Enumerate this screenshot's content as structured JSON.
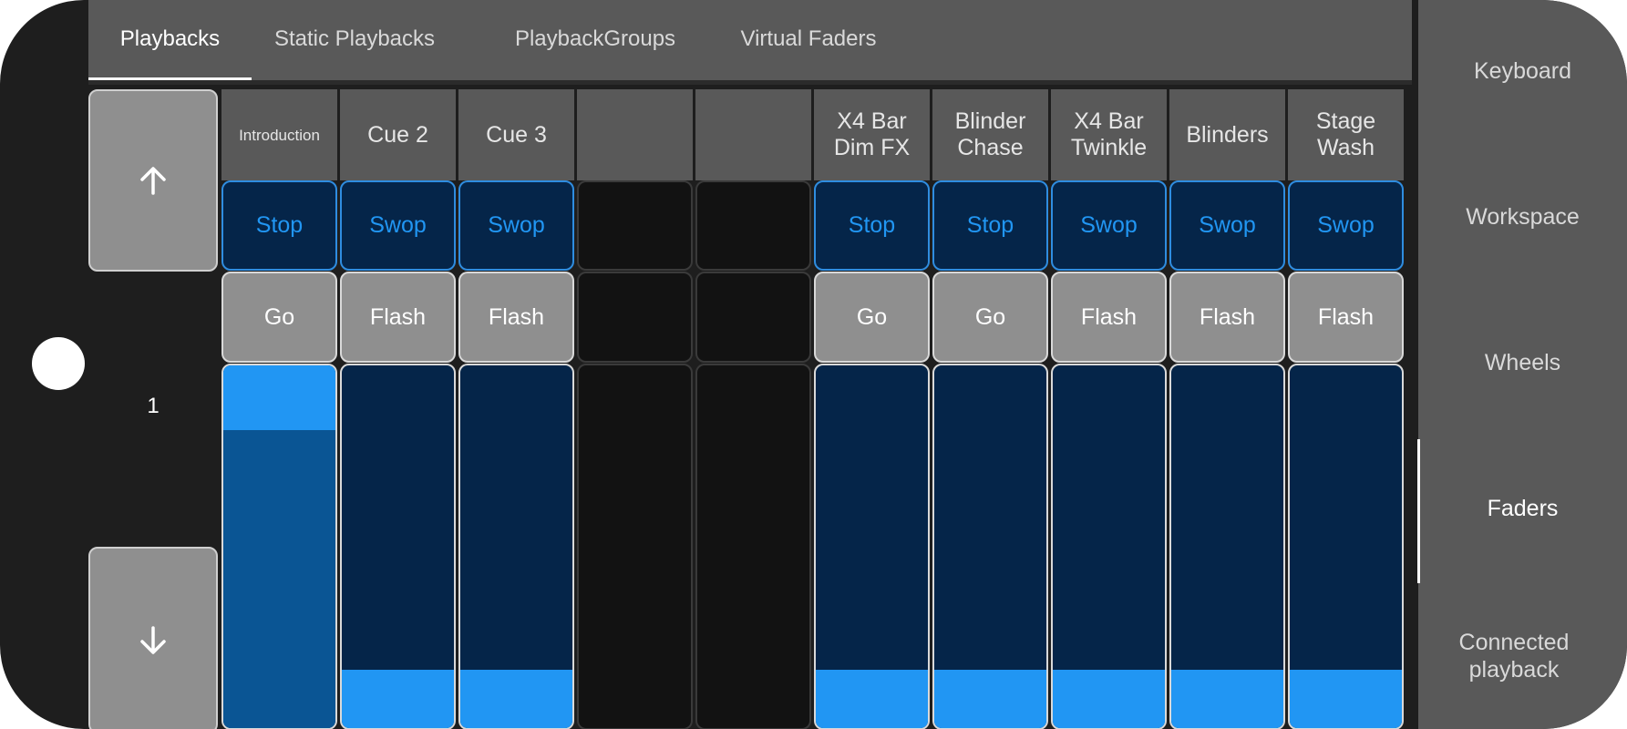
{
  "tabs": [
    {
      "label": "Playbacks",
      "active": true
    },
    {
      "label": "Static Playbacks",
      "active": false
    },
    {
      "label": "PlaybackGroups",
      "active": false
    },
    {
      "label": "Virtual Faders",
      "active": false
    }
  ],
  "page_nav": {
    "up_icon": "arrow-up-icon",
    "down_icon": "arrow-down-icon",
    "page_number": "1"
  },
  "playbacks": [
    {
      "title": "Introduction",
      "top_button": "Stop",
      "bottom_button": "Go",
      "fader_level": 1.0
    },
    {
      "title": "Cue 2",
      "top_button": "Swop",
      "bottom_button": "Flash",
      "fader_level": 0.16
    },
    {
      "title": "Cue 3",
      "top_button": "Swop",
      "bottom_button": "Flash",
      "fader_level": 0.16
    },
    {
      "title": "",
      "top_button": "",
      "bottom_button": "",
      "fader_level": 0
    },
    {
      "title": "",
      "top_button": "",
      "bottom_button": "",
      "fader_level": 0
    },
    {
      "title": "X4 Bar Dim FX",
      "top_button": "Stop",
      "bottom_button": "Go",
      "fader_level": 0.16
    },
    {
      "title": "Blinder Chase",
      "top_button": "Stop",
      "bottom_button": "Go",
      "fader_level": 0.16
    },
    {
      "title": "X4 Bar Twinkle",
      "top_button": "Swop",
      "bottom_button": "Flash",
      "fader_level": 0.16
    },
    {
      "title": "Blinders",
      "top_button": "Swop",
      "bottom_button": "Flash",
      "fader_level": 0.16
    },
    {
      "title": "Stage Wash",
      "top_button": "Swop",
      "bottom_button": "Flash",
      "fader_level": 0.16
    }
  ],
  "sidebar": {
    "items": [
      {
        "label": "Keyboard"
      },
      {
        "label": "Workspace"
      },
      {
        "label": "Wheels"
      },
      {
        "label": "Faders",
        "active": true
      },
      {
        "label": "Connected playback"
      }
    ]
  },
  "colors": {
    "accent": "#2196f3",
    "panel": "#595959",
    "button_grey": "#8f8f8f",
    "fader_bg": "#052549"
  }
}
